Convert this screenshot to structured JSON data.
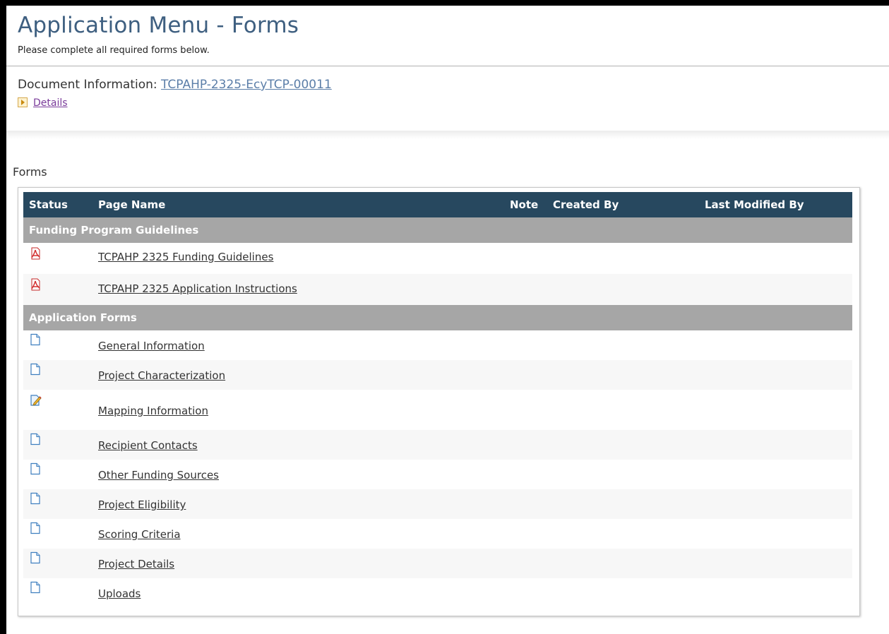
{
  "header": {
    "title": "Application Menu - Forms",
    "subtitle": "Please complete all required forms below."
  },
  "document": {
    "label": "Document Information:",
    "id": "TCPAHP-2325-EcyTCP-00011",
    "details_label": "Details"
  },
  "forms_section_label": "Forms",
  "table": {
    "columns": {
      "status": "Status",
      "page_name": "Page Name",
      "note": "Note",
      "created_by": "Created By",
      "last_modified_by": "Last Modified By"
    },
    "groups": [
      {
        "name": "Funding Program Guidelines",
        "items": [
          {
            "name": "TCPAHP 2325 Funding Guidelines",
            "icon": "pdf-icon"
          },
          {
            "name": "TCPAHP 2325 Application Instructions",
            "icon": "pdf-icon"
          }
        ]
      },
      {
        "name": "Application Forms",
        "items": [
          {
            "name": "General Information",
            "icon": "blank-page-icon"
          },
          {
            "name": "Project Characterization",
            "icon": "blank-page-icon"
          },
          {
            "name": "Mapping Information",
            "icon": "edit-page-icon"
          },
          {
            "name": "Recipient Contacts",
            "icon": "blank-page-icon"
          },
          {
            "name": "Other Funding Sources",
            "icon": "blank-page-icon"
          },
          {
            "name": "Project Eligibility",
            "icon": "blank-page-icon"
          },
          {
            "name": "Scoring Criteria",
            "icon": "blank-page-icon"
          },
          {
            "name": "Project Details",
            "icon": "blank-page-icon"
          },
          {
            "name": "Uploads",
            "icon": "blank-page-icon"
          }
        ]
      }
    ]
  },
  "colors": {
    "title": "#3e5f80",
    "table_header": "#27485f",
    "group_header": "#a6a6a6",
    "link": "#333333",
    "details_link": "#7a3b9a"
  }
}
